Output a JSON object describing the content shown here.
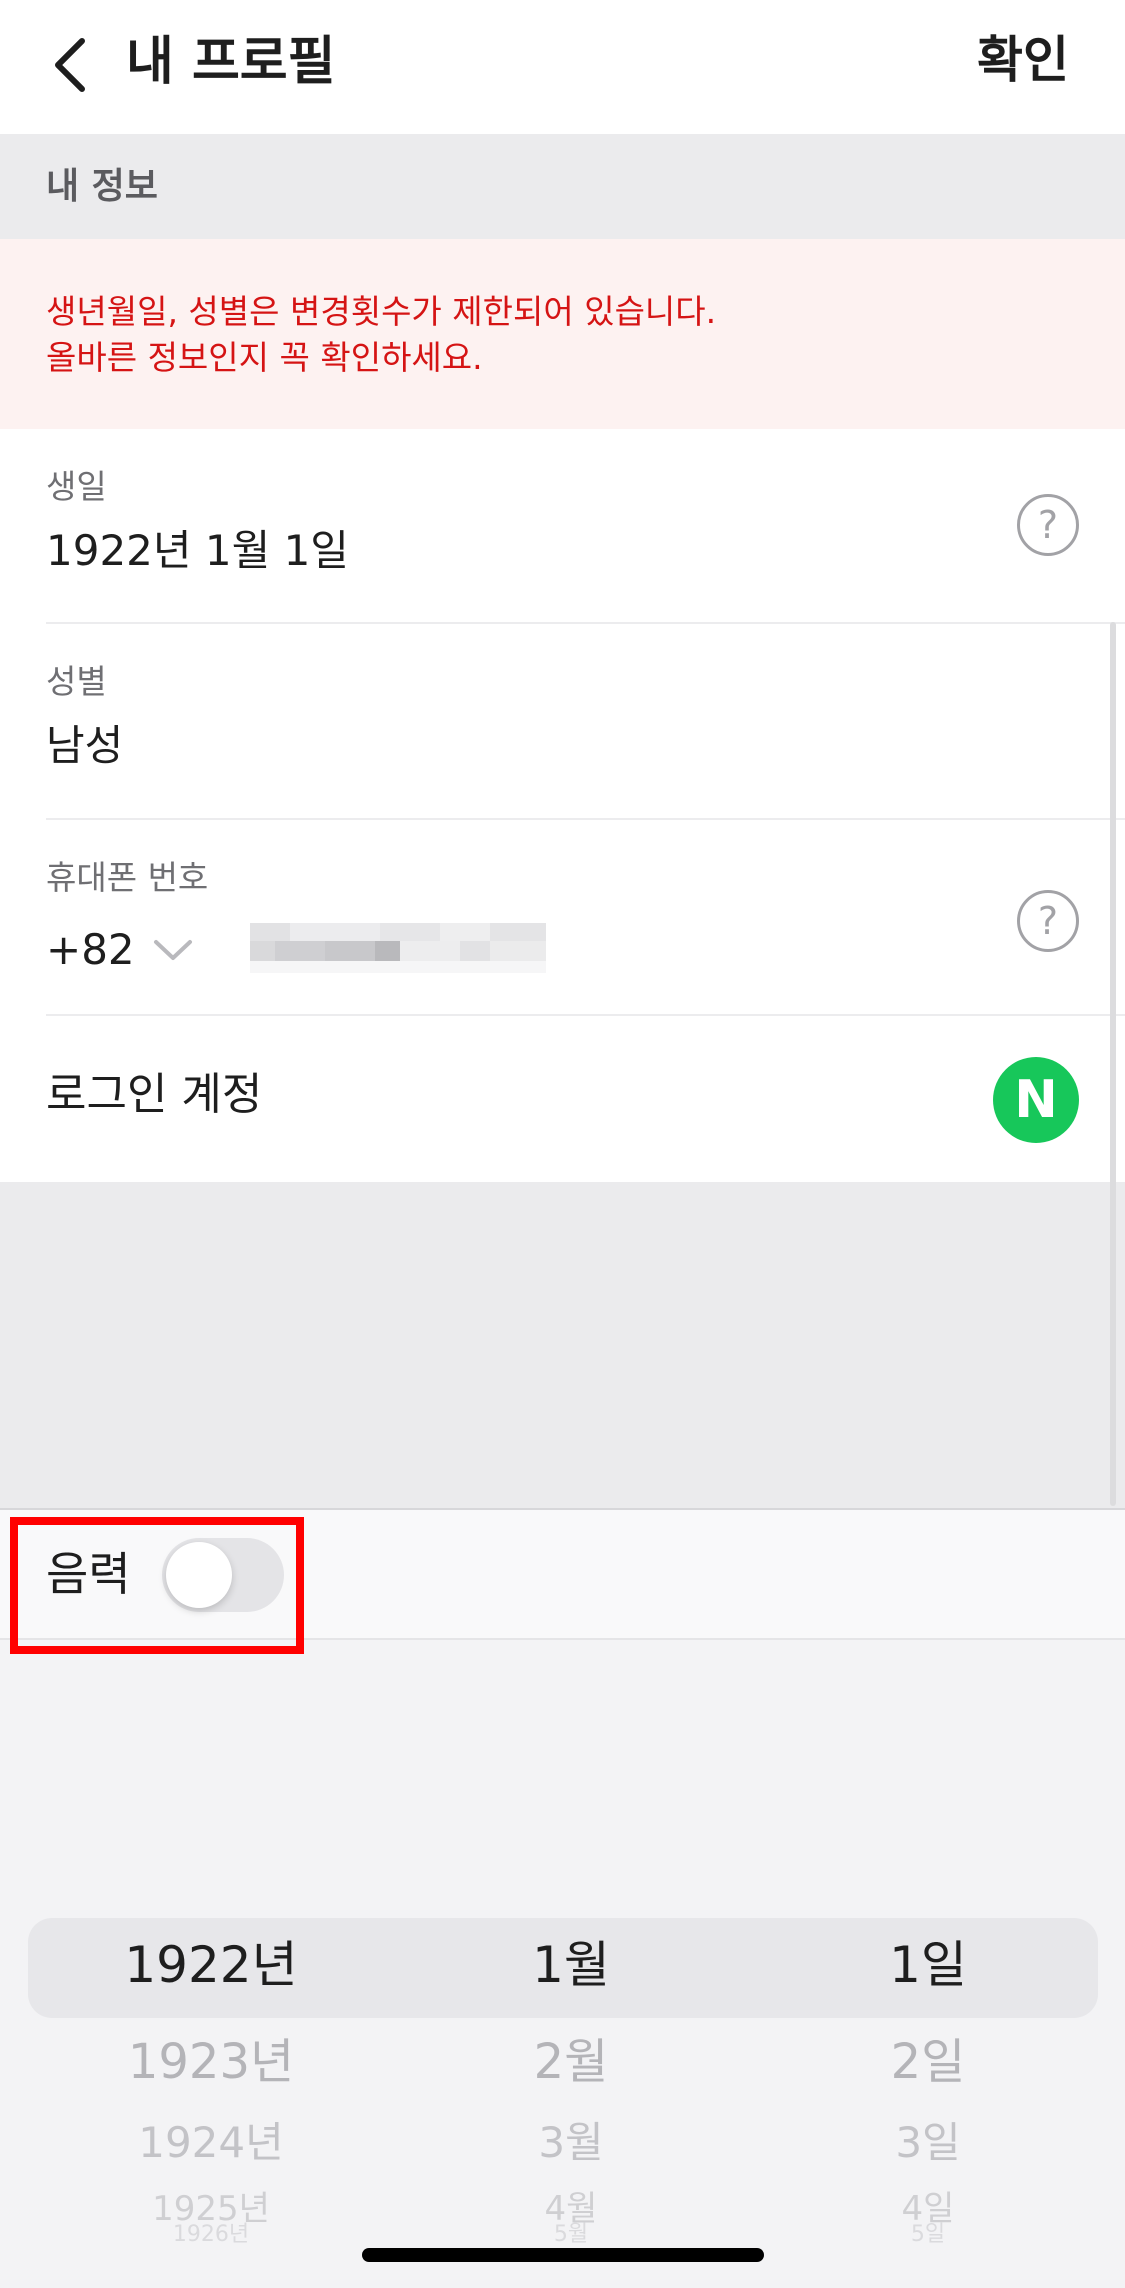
{
  "nav": {
    "back_icon": "chevron-left-icon",
    "title": "내 프로필",
    "confirm_label": "확인"
  },
  "section": {
    "header": "내 정보"
  },
  "warning": {
    "line1": "생년월일, 성별은 변경횟수가 제한되어 있습니다.",
    "line2": "올바른 정보인지 꼭 확인하세요.",
    "color": "#d51414"
  },
  "fields": {
    "birthday": {
      "label": "생일",
      "value": "1922년 1월 1일",
      "help_icon": "?"
    },
    "gender": {
      "label": "성별",
      "value": "남성"
    },
    "phone": {
      "label": "휴대폰 번호",
      "country_code": "+82",
      "help_icon": "?"
    },
    "login": {
      "label": "로그인 계정",
      "provider_badge": "N",
      "provider_color": "#17c75a"
    }
  },
  "lunar": {
    "label": "음력",
    "enabled": false
  },
  "picker": {
    "years": [
      "1922년",
      "1923년",
      "1924년",
      "1925년",
      "1926년"
    ],
    "months": [
      "1월",
      "2월",
      "3월",
      "4월",
      "5월"
    ],
    "days": [
      "1일",
      "2일",
      "3일",
      "4일",
      "5일"
    ],
    "selected": {
      "year": "1922년",
      "month": "1월",
      "day": "1일"
    }
  }
}
